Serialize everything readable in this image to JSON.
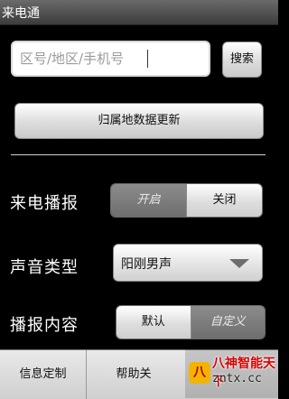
{
  "titlebar": {
    "title": "来电通"
  },
  "search": {
    "placeholder": "区号/地区/手机号",
    "value": "",
    "button_label": "搜索"
  },
  "update_button_label": "归属地数据更新",
  "announce": {
    "label": "来电播报",
    "on_label": "开启",
    "off_label": "关闭",
    "selected": "关闭"
  },
  "voice": {
    "label": "声音类型",
    "selected": "阳刚男声"
  },
  "content": {
    "label": "播报内容",
    "default_label": "默认",
    "custom_label": "自定义",
    "selected": "默认"
  },
  "bottombar": {
    "tab1": "信息定制",
    "tab2": "帮助关"
  },
  "watermark": {
    "line1": "八神智能天下",
    "line2": "zntx.cc",
    "icon_text": "八"
  }
}
